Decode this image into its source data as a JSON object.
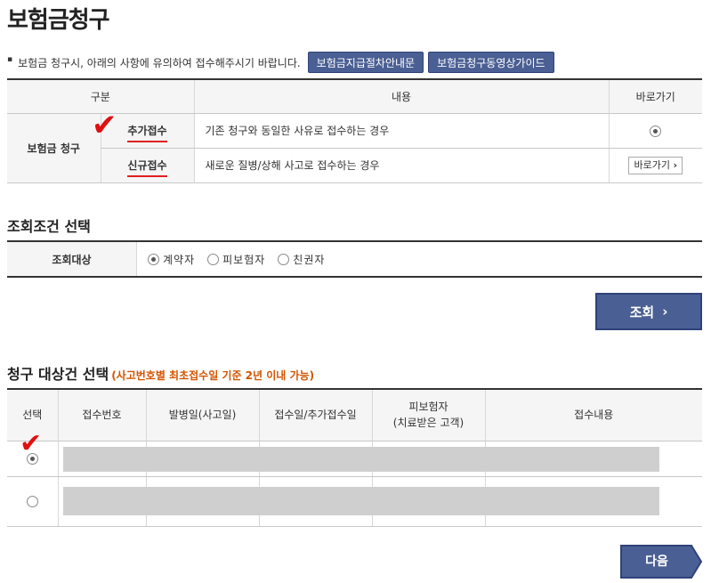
{
  "page": {
    "title": "보험금청구"
  },
  "notice": {
    "text": "보험금 청구시, 아래의 사항에 유의하여 접수해주시기 바랍니다.",
    "buttons": [
      "보험금지급절차안내문",
      "보험금청구동영상가이드"
    ]
  },
  "claim_type_table": {
    "headers": {
      "category": "구분",
      "content": "내용",
      "shortcut": "바로가기"
    },
    "category": "보험금 청구",
    "rows": [
      {
        "type": "추가접수",
        "description": "기존 청구와 동일한 사유로 접수하는 경우",
        "selected": true
      },
      {
        "type": "신규접수",
        "description": "새로운 질병/상해 사고로 접수하는 경우",
        "button_label": "바로가기",
        "button_arrow": "›"
      }
    ]
  },
  "search_condition": {
    "title": "조회조건 선택",
    "label": "조회대상",
    "options": [
      {
        "label": "계약자",
        "selected": true
      },
      {
        "label": "피보험자",
        "selected": false
      },
      {
        "label": "친권자",
        "selected": false
      }
    ],
    "search_button": "조회",
    "search_arrow": "›"
  },
  "claim_target": {
    "title": "청구 대상건 선택",
    "note": "(사고번호별 최초접수일 기준 2년 이내 가능)",
    "headers": {
      "select": "선택",
      "receipt_no": "접수번호",
      "onset_date": "발병일(사고일)",
      "receipt_date": "접수일/추가접수일",
      "insured_line1": "피보험자",
      "insured_line2": "(치료받은 고객)",
      "details": "접수내용"
    },
    "rows": [
      {
        "selected": true
      },
      {
        "selected": false
      }
    ]
  },
  "footer": {
    "next_button": "다음"
  },
  "colors": {
    "button_blue": "#4a5f93",
    "accent_red": "#e02020",
    "note_orange": "#d35400",
    "redaction_gray": "#cfcfcf"
  }
}
